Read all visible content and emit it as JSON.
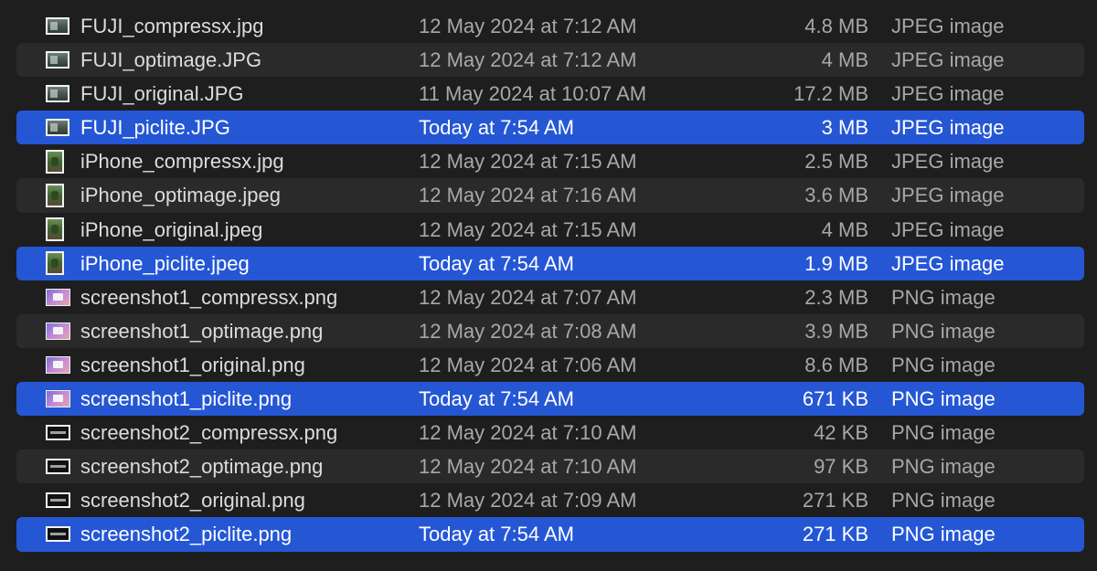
{
  "files": [
    {
      "name": "FUJI_compressx.jpg",
      "date": "12 May 2024 at 7:12 AM",
      "size": "4.8 MB",
      "kind": "JPEG image",
      "icon": "photo-landscape-icon",
      "selected": false
    },
    {
      "name": "FUJI_optimage.JPG",
      "date": "12 May 2024 at 7:12 AM",
      "size": "4 MB",
      "kind": "JPEG image",
      "icon": "photo-landscape-icon",
      "selected": false
    },
    {
      "name": "FUJI_original.JPG",
      "date": "11 May 2024 at 10:07 AM",
      "size": "17.2 MB",
      "kind": "JPEG image",
      "icon": "photo-landscape-icon",
      "selected": false
    },
    {
      "name": "FUJI_piclite.JPG",
      "date": "Today at 7:54 AM",
      "size": "3 MB",
      "kind": "JPEG image",
      "icon": "photo-landscape-icon",
      "selected": true
    },
    {
      "name": "iPhone_compressx.jpg",
      "date": "12 May 2024 at 7:15 AM",
      "size": "2.5 MB",
      "kind": "JPEG image",
      "icon": "photo-portrait-icon",
      "selected": false
    },
    {
      "name": "iPhone_optimage.jpeg",
      "date": "12 May 2024 at 7:16 AM",
      "size": "3.6 MB",
      "kind": "JPEG image",
      "icon": "photo-portrait-icon",
      "selected": false
    },
    {
      "name": "iPhone_original.jpeg",
      "date": "12 May 2024 at 7:15 AM",
      "size": "4 MB",
      "kind": "JPEG image",
      "icon": "photo-portrait-icon",
      "selected": false
    },
    {
      "name": "iPhone_piclite.jpeg",
      "date": "Today at 7:54 AM",
      "size": "1.9 MB",
      "kind": "JPEG image",
      "icon": "photo-portrait-icon",
      "selected": true
    },
    {
      "name": "screenshot1_compressx.png",
      "date": "12 May 2024 at 7:07 AM",
      "size": "2.3 MB",
      "kind": "PNG image",
      "icon": "screenshot-pink-icon",
      "selected": false
    },
    {
      "name": "screenshot1_optimage.png",
      "date": "12 May 2024 at 7:08 AM",
      "size": "3.9 MB",
      "kind": "PNG image",
      "icon": "screenshot-pink-icon",
      "selected": false
    },
    {
      "name": "screenshot1_original.png",
      "date": "12 May 2024 at 7:06 AM",
      "size": "8.6 MB",
      "kind": "PNG image",
      "icon": "screenshot-pink-icon",
      "selected": false
    },
    {
      "name": "screenshot1_piclite.png",
      "date": "Today at 7:54 AM",
      "size": "671 KB",
      "kind": "PNG image",
      "icon": "screenshot-pink-icon",
      "selected": true
    },
    {
      "name": "screenshot2_compressx.png",
      "date": "12 May 2024 at 7:10 AM",
      "size": "42 KB",
      "kind": "PNG image",
      "icon": "screenshot-dark-icon",
      "selected": false
    },
    {
      "name": "screenshot2_optimage.png",
      "date": "12 May 2024 at 7:10 AM",
      "size": "97 KB",
      "kind": "PNG image",
      "icon": "screenshot-dark-icon",
      "selected": false
    },
    {
      "name": "screenshot2_original.png",
      "date": "12 May 2024 at 7:09 AM",
      "size": "271 KB",
      "kind": "PNG image",
      "icon": "screenshot-dark-icon",
      "selected": false
    },
    {
      "name": "screenshot2_piclite.png",
      "date": "Today at 7:54 AM",
      "size": "271 KB",
      "kind": "PNG image",
      "icon": "screenshot-dark-icon",
      "selected": true
    }
  ],
  "colors": {
    "background": "#1e1e1e",
    "alternate_row": "#2a2a2a",
    "selection": "#2557d5",
    "primary_text": "#dcdcdc",
    "secondary_text": "#a8a8a8"
  }
}
